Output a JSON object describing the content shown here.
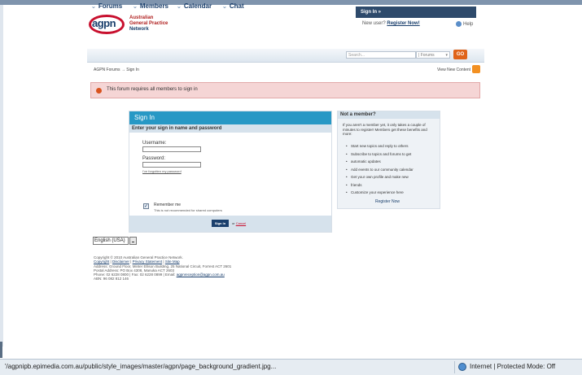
{
  "logo": {
    "mark": "agpn",
    "org_line1": "Australian",
    "org_line2": "General Practice",
    "org_line3": "Network"
  },
  "header": {
    "signin_tab": "Sign In »",
    "new_user_text": "New user?",
    "register_now": "Register Now!",
    "help": "Help"
  },
  "nav": {
    "items": [
      {
        "label": "Forums"
      },
      {
        "label": "Members"
      },
      {
        "label": "Calendar"
      },
      {
        "label": "Chat"
      }
    ],
    "search_placeholder": "Search...",
    "search_scope": "Forums",
    "go_label": "GO"
  },
  "breadcrumb": "AGPN Forums → Sign In",
  "view_new_content": "View New Content",
  "alert": {
    "text": "This forum requires all members to sign in"
  },
  "signin": {
    "title": "Sign In",
    "subtitle": "Enter your sign in name and password",
    "username_label": "Username:",
    "password_label": "Password:",
    "forgot_link": "I've forgotten my password",
    "remember_label": "Remember me",
    "remember_note": "This is not recommended for shared computers",
    "remember_checked": true,
    "submit_label": "Sign In",
    "or_text": "or",
    "cancel_label": "Cancel"
  },
  "not_member": {
    "title": "Not a member?",
    "intro": "If you aren't a member yet, it only takes a couple of minutes to register! Members get these benefits and more:",
    "benefits": [
      "Start new topics and reply to others",
      "Subscribe to topics and forums to get",
      "automatic updates",
      "Add events to our community calendar",
      "Get your own profile and make new",
      "friends",
      "Customize your experience here"
    ],
    "register_link": "Register Now"
  },
  "language": {
    "selected": "English (USA)"
  },
  "footer": {
    "copyright": "Copyright © 2010 Australian General Practice Network.",
    "links": [
      "Copyright",
      "Disclaimer",
      "Privacy Statement",
      "Site Map"
    ],
    "address": "Address: Ground Floor, Minter Ellison Building, 25 National Circuit, Forrest ACT 2601",
    "postal": "Postal Address: PO Box 4308, Manuka ACT 2603",
    "phone_line_prefix": "Phone: 02 6228 0800 | Fax: 02 6228 0899 | Email:",
    "email": "agpnreception@agpn.com.au",
    "abn": "ABN: 96 082 812 146"
  },
  "statusbar": {
    "url": "'/agpnipb.epimedia.com.au/public/style_images/master/agpn/page_background_gradient.jpg...",
    "zone": "Internet | Protected Mode: Off"
  },
  "colors": {
    "nav_text": "#1a3f6c",
    "signin_header": "#2798c5",
    "alert_bg": "#f5d5d5",
    "go_button": "#e0641a"
  }
}
